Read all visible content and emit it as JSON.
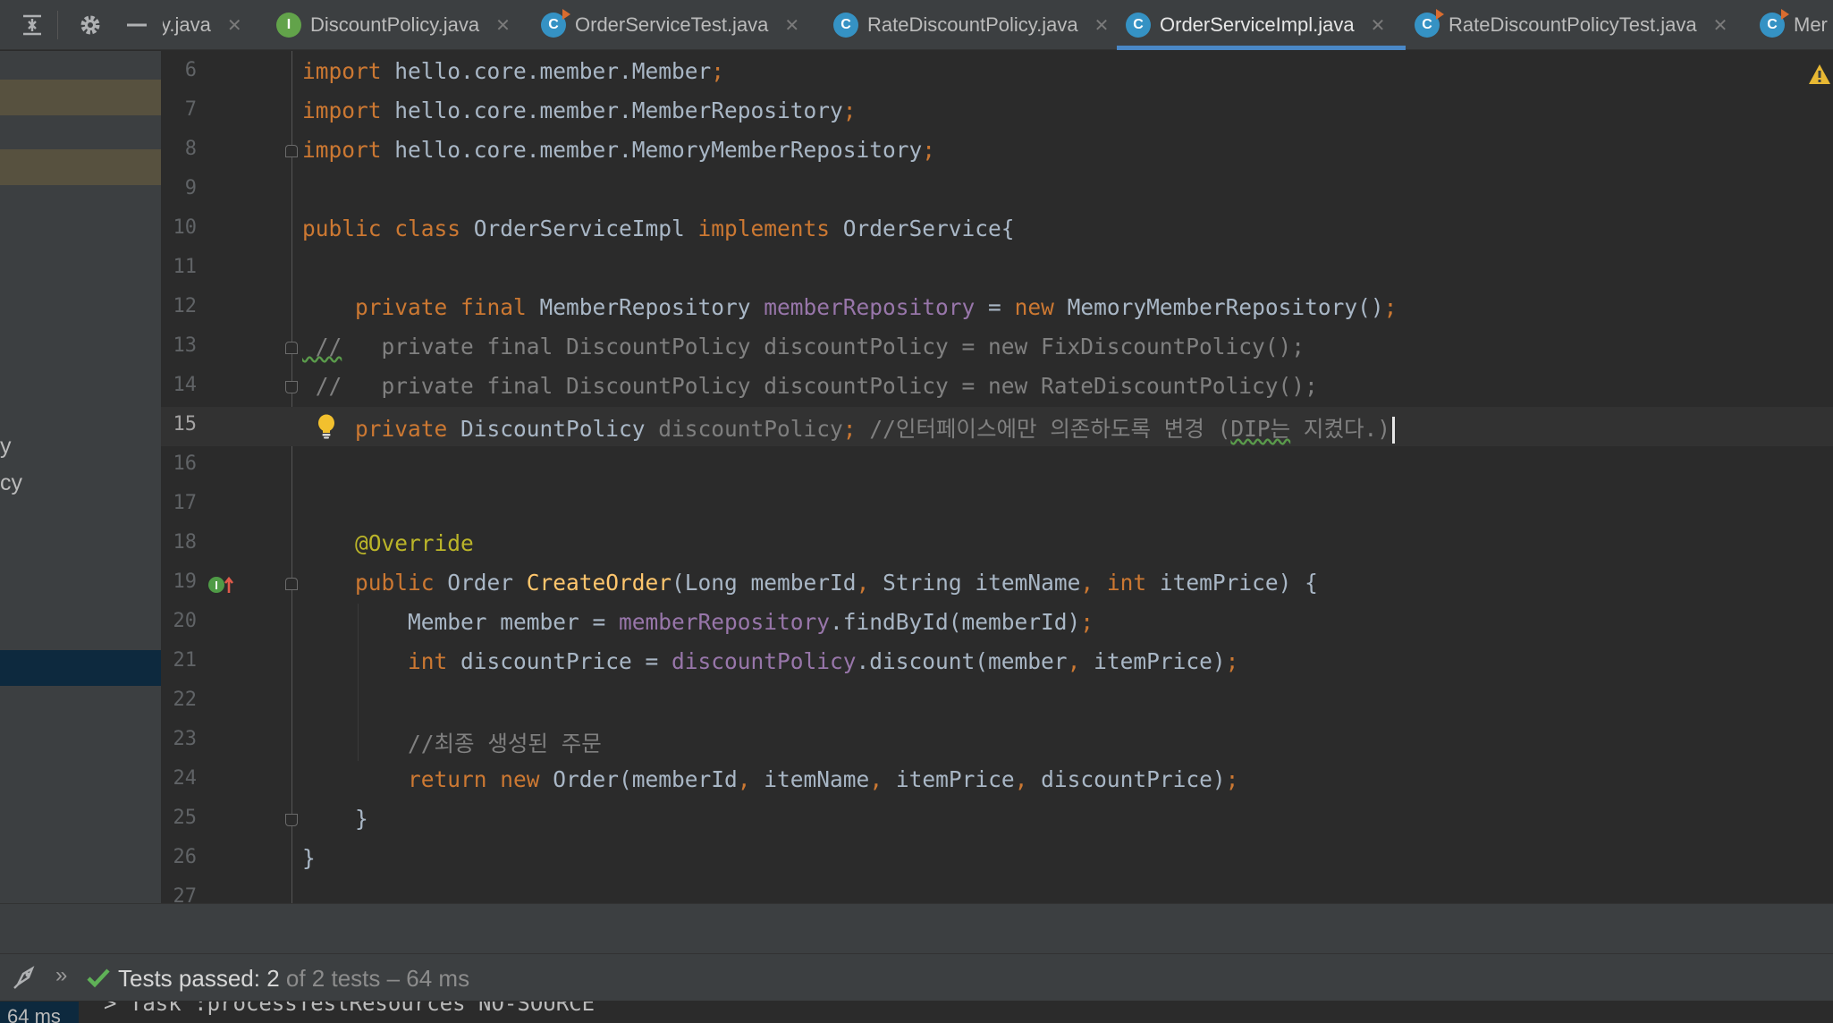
{
  "tabs": [
    {
      "name": "y.java",
      "icon": "none",
      "active": false
    },
    {
      "name": "DiscountPolicy.java",
      "icon": "interface",
      "glyph": "I",
      "active": false
    },
    {
      "name": "OrderServiceTest.java",
      "icon": "class-runnable",
      "glyph": "C",
      "active": false
    },
    {
      "name": "RateDiscountPolicy.java",
      "icon": "class",
      "glyph": "C",
      "active": false
    },
    {
      "name": "OrderServiceImpl.java",
      "icon": "class",
      "glyph": "C",
      "active": true
    },
    {
      "name": "RateDiscountPolicyTest.java",
      "icon": "class-runnable",
      "glyph": "C",
      "active": false
    },
    {
      "name": "Mer",
      "icon": "class-runnable",
      "glyph": "C",
      "active": false
    }
  ],
  "left_panel": {
    "text_1": "y",
    "text_2": "cy"
  },
  "editor": {
    "current_line": 15,
    "lines": [
      {
        "n": "6",
        "p1": "import",
        "p2": " hello.core.member.Member",
        "p3": ";"
      },
      {
        "n": "7",
        "p1": "import",
        "p2": " hello.core.member.MemberRepository",
        "p3": ";"
      },
      {
        "n": "8",
        "p1": "import",
        "p2": " hello.core.member.MemoryMemberRepository",
        "p3": ";"
      },
      {
        "n": "9"
      },
      {
        "n": "10",
        "p1": "public class ",
        "p2": "OrderServiceImpl ",
        "p3": "implements ",
        "p4": "OrderService{"
      },
      {
        "n": "11"
      },
      {
        "n": "12",
        "p1": "    private final ",
        "p2": "MemberRepository ",
        "p3": "memberRepository",
        "p4": " = ",
        "p5": "new ",
        "p6": "MemoryMemberRepository()",
        "p7": ";"
      },
      {
        "n": "13",
        "p1": " //",
        "p2": "   private final DiscountPolicy discountPolicy = new FixDiscountPolicy();"
      },
      {
        "n": "14",
        "p1": " //   private final DiscountPolicy discountPolicy = new RateDiscountPolicy();"
      },
      {
        "n": "15",
        "p1": "    private ",
        "p2": "DiscountPolicy ",
        "p3": "discountPolicy",
        "p4": "; ",
        "p5": "//인터페이스에만 의존하도록 변경 (",
        "p6": "DIP는",
        "p7": " 지켰다.)"
      },
      {
        "n": "16"
      },
      {
        "n": "17"
      },
      {
        "n": "18",
        "p1": "    @Override"
      },
      {
        "n": "19",
        "p1": "    public ",
        "p2": "Order ",
        "p3": "CreateOrder",
        "p4": "(Long memberId",
        "p5": ", ",
        "p6": "String itemName",
        "p7": ", ",
        "p8": "int ",
        "p9": "itemPrice) {"
      },
      {
        "n": "20",
        "p1": "        Member member = ",
        "p2": "memberRepository",
        "p3": ".findById(memberId)",
        "p4": ";"
      },
      {
        "n": "21",
        "p1": "        int ",
        "p2": "discountPrice = ",
        "p3": "discountPolicy",
        "p4": ".discount(member",
        "p5": ", ",
        "p6": "itemPrice)",
        "p7": ";"
      },
      {
        "n": "22"
      },
      {
        "n": "23",
        "p1": "        //최종 생성된 주문"
      },
      {
        "n": "24",
        "p1": "        return new ",
        "p2": "Order(memberId",
        "p3": ", ",
        "p4": "itemName",
        "p5": ", ",
        "p6": "itemPrice",
        "p7": ", ",
        "p8": "discountPrice)",
        "p9": ";"
      },
      {
        "n": "25",
        "p1": "    }"
      },
      {
        "n": "26",
        "p1": "}"
      },
      {
        "n": "27"
      }
    ]
  },
  "run": {
    "status": "Tests passed: 2",
    "detail": " of 2 tests – 64 ms",
    "time": "64 ms",
    "console_line": "> Task :processTestResources NO-SOURCE"
  },
  "colors": {
    "background": "#2b2b2b",
    "panel": "#3c3f41",
    "keyword": "#cc7832",
    "field": "#9876aa",
    "method": "#ffc66d",
    "annotation": "#bbb529",
    "comment": "#808080",
    "accent": "#4a88c7",
    "success": "#5fb157"
  },
  "icons": [
    "collapse-all-icon",
    "gear-icon",
    "minimize-icon",
    "interface-icon",
    "class-icon",
    "close-icon",
    "warning-icon",
    "lightbulb-icon",
    "implementation-marker-icon",
    "fold-icon",
    "run-tool-icon",
    "chevron-double-right-icon",
    "check-icon"
  ]
}
